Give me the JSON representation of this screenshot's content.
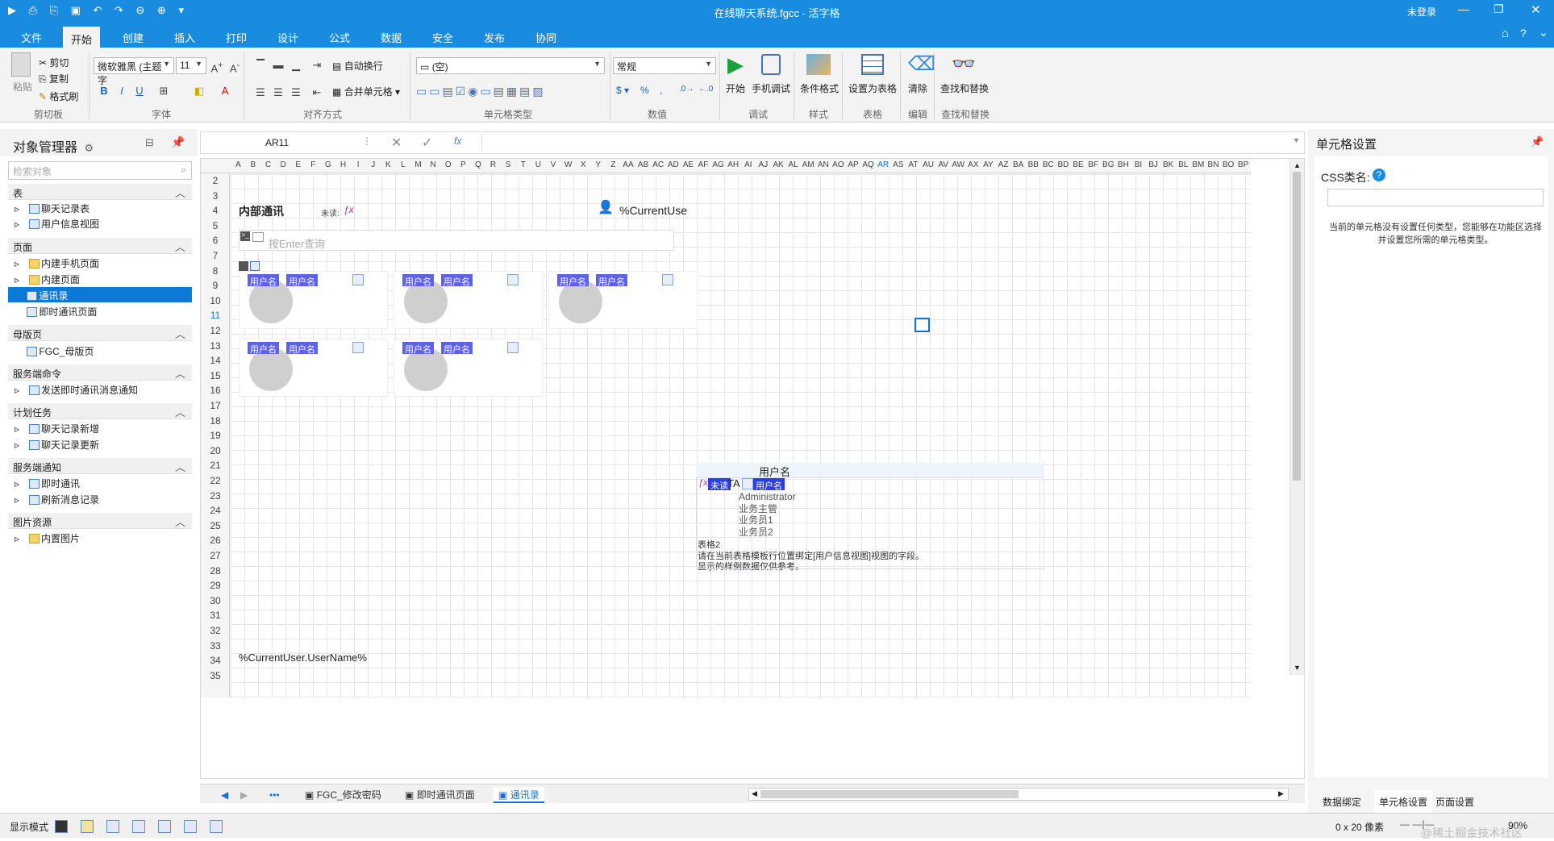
{
  "titlebar": {
    "title": "在线聊天系统.fgcc - 活字格",
    "login": "未登录"
  },
  "menu": [
    "文件",
    "开始",
    "创建",
    "插入",
    "打印",
    "设计",
    "公式",
    "数据",
    "安全",
    "发布",
    "协同"
  ],
  "ribbon": {
    "clipboard": {
      "paste": "粘贴",
      "cut": "剪切",
      "copy": "复制",
      "format_painter": "格式刷",
      "label": "剪切板"
    },
    "font": {
      "name": "微软雅黑 (主题字",
      "size": "11",
      "label": "字体"
    },
    "align": {
      "wrap": "自动换行",
      "merge": "合并单元格",
      "label": "对齐方式"
    },
    "celltype": {
      "value": "(空)",
      "label": "单元格类型"
    },
    "number": {
      "format": "常规",
      "label": "数值"
    },
    "debug": {
      "start": "开始",
      "mobile": "手机调试",
      "label": "调试"
    },
    "style": {
      "cond": "条件格式",
      "label": "样式"
    },
    "table": {
      "set_table": "设置为表格",
      "label": "表格"
    },
    "edit": {
      "clear": "清除",
      "label": "编辑"
    },
    "find": {
      "find_replace": "查找和替换",
      "label": "查找和替换"
    }
  },
  "left_panel": {
    "title": "对象管理器",
    "search_placeholder": "检索对象",
    "sections": [
      {
        "name": "表",
        "items": [
          "聊天记录表",
          "用户信息视图"
        ]
      },
      {
        "name": "页面",
        "items": [
          "内建手机页面",
          "内建页面",
          "通讯录",
          "即时通讯页面"
        ]
      },
      {
        "name": "母版页",
        "items": [
          "FGC_母版页"
        ]
      },
      {
        "name": "服务端命令",
        "items": [
          "发送即时通讯消息通知"
        ]
      },
      {
        "name": "计划任务",
        "items": [
          "聊天记录新增",
          "聊天记录更新"
        ]
      },
      {
        "name": "服务端通知",
        "items": [
          "即时通讯",
          "刷新消息记录"
        ]
      },
      {
        "name": "图片资源",
        "items": [
          "内置图片"
        ]
      }
    ],
    "selected": "通讯录"
  },
  "formula": {
    "cell_ref": "AR11",
    "fx": "fx"
  },
  "sheet": {
    "columns": [
      "A",
      "B",
      "C",
      "D",
      "E",
      "F",
      "G",
      "H",
      "I",
      "J",
      "K",
      "L",
      "M",
      "N",
      "O",
      "P",
      "Q",
      "R",
      "S",
      "T",
      "U",
      "V",
      "W",
      "X",
      "Y",
      "Z",
      "AA",
      "AB",
      "AC",
      "AD",
      "AE",
      "AF",
      "AG",
      "AH",
      "AI",
      "AJ",
      "AK",
      "AL",
      "AM",
      "AN",
      "AO",
      "AP",
      "AQ",
      "AR",
      "AS",
      "AT",
      "AU",
      "AV",
      "AW",
      "AX",
      "AY",
      "AZ",
      "BA",
      "BB",
      "BC",
      "BD",
      "BE",
      "BF",
      "BG",
      "BH",
      "BI",
      "BJ",
      "BK",
      "BL",
      "BM",
      "BN",
      "BO",
      "BP"
    ],
    "rows": [
      "2",
      "3",
      "4",
      "5",
      "6",
      "7",
      "8",
      "9",
      "10",
      "11",
      "12",
      "13",
      "14",
      "15",
      "16",
      "17",
      "18",
      "19",
      "20",
      "21",
      "22",
      "23",
      "24",
      "25",
      "26",
      "27",
      "28",
      "29",
      "30",
      "31",
      "32",
      "33",
      "34",
      "35"
    ],
    "title": "内部通讯",
    "unread_label": "未读:",
    "current_user": "%CurrentUse",
    "search_placeholder": "按Enter查询",
    "username_tag": "用户名",
    "table2": {
      "header": "用户名",
      "unread_tag": "未读",
      "ta": "TA",
      "rows": [
        "Administrator",
        "业务主管",
        "业务员1",
        "业务员2"
      ],
      "caption": "表格2",
      "note1": "请在当前表格模板行位置绑定[用户信息视图]视图的字段。",
      "note2": "显示的样例数据仅供参考。"
    },
    "footer_cell": "%CurrentUser.UserName%"
  },
  "sheet_tabs": [
    "FGC_修改密码",
    "即时通讯页面",
    "通讯录"
  ],
  "right_panel": {
    "title": "单元格设置",
    "css_label": "CSS类名:",
    "message": "当前的单元格没有设置任何类型，您能够在功能区选择并设置您所需的单元格类型。",
    "tabs": [
      "数据绑定",
      "单元格设置",
      "页面设置"
    ]
  },
  "status": {
    "mode": "显示模式",
    "size": "0 x 20 像素",
    "zoom": "90%",
    "watermark": "@稀土掘金技术社区"
  }
}
